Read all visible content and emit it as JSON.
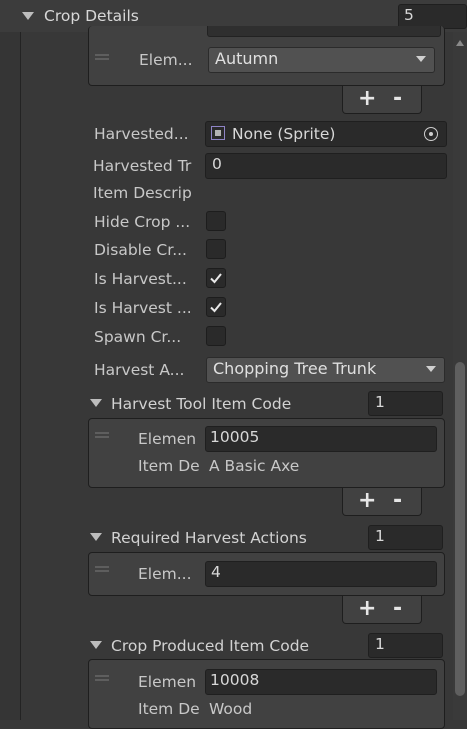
{
  "header": {
    "title": "Crop Details",
    "size": "5"
  },
  "element_row": {
    "label": "Elem...",
    "value": "Autumn"
  },
  "list_buttons": {
    "plus": "+",
    "minus": "-"
  },
  "fields": {
    "harvested_sprite": {
      "label": "Harvested...",
      "value": "None (Sprite)"
    },
    "harvested_transform": {
      "label": "Harvested Tr",
      "value": "0"
    },
    "item_description": {
      "label": "Item Descrip"
    },
    "hide_crop": {
      "label": "Hide Crop ...",
      "checked": false
    },
    "disable_crop": {
      "label": "Disable Cr...",
      "checked": false
    },
    "is_harvested_1": {
      "label": "Is Harvest...",
      "checked": true
    },
    "is_harvested_2": {
      "label": "Is Harvest ...",
      "checked": true
    },
    "spawn_crop": {
      "label": "Spawn Cr...",
      "checked": false
    },
    "harvest_action": {
      "label": "Harvest A...",
      "value": "Chopping Tree Trunk"
    }
  },
  "harvest_tool": {
    "title": "Harvest Tool Item Code",
    "size": "1",
    "element_label": "Elemen",
    "element_value": "10005",
    "desc_label": "Item De",
    "desc_value": "A Basic Axe"
  },
  "required_actions": {
    "title": "Required Harvest Actions",
    "size": "1",
    "element_label": "Elem...",
    "element_value": "4"
  },
  "crop_produced": {
    "title": "Crop Produced Item Code",
    "size": "1",
    "element_label": "Elemen",
    "element_value": "10008",
    "desc_label": "Item De",
    "desc_value": "Wood"
  }
}
